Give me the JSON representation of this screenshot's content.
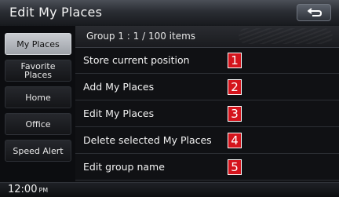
{
  "header": {
    "title": "Edit My Places",
    "back_icon": "return-arrow-icon"
  },
  "group_bar": {
    "label": "Group 1 : 1 / 100 items"
  },
  "tabs": [
    {
      "label": "My Places",
      "active": true
    },
    {
      "label": "Favorite Places",
      "active": false
    },
    {
      "label": "Home",
      "active": false
    },
    {
      "label": "Office",
      "active": false
    },
    {
      "label": "Speed Alert",
      "active": false
    }
  ],
  "menu": {
    "items": [
      {
        "label": "Store current position",
        "number": "1"
      },
      {
        "label": "Add My Places",
        "number": "2"
      },
      {
        "label": "Edit My Places",
        "number": "3"
      },
      {
        "label": "Delete selected My Places",
        "number": "4"
      },
      {
        "label": "Edit group name",
        "number": "5"
      }
    ]
  },
  "status": {
    "time": "12:00",
    "ampm": "PM"
  },
  "colors": {
    "badge": "#d4141c",
    "active_tab": "#c9ccd1"
  }
}
